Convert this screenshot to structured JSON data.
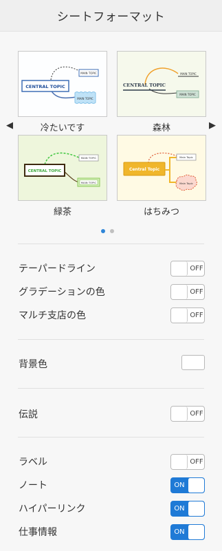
{
  "header": {
    "title": "シートフォーマット"
  },
  "themes": [
    {
      "label": "冷たいです",
      "central": "CENTRAL TOPIC",
      "main1": "MAIN TOPIC",
      "main2": "MAIN TOPIC"
    },
    {
      "label": "森林",
      "central": "CENTRAL TOPIC",
      "main1": "MAIN TOPIC",
      "main2": "MAIN TOPIC"
    },
    {
      "label": "緑茶",
      "central": "CENTRAL TOPIC",
      "main1": "MAIN TOPIC",
      "main2": "MAIN TOPIC"
    },
    {
      "label": "はちみつ",
      "central": "Central Topic",
      "main1": "Main Topic",
      "main2": "Main Topic"
    }
  ],
  "pager": {
    "page_count": 2,
    "active_page": 1
  },
  "settings": {
    "tapered_line": {
      "label": "テーパードライン",
      "state": "OFF"
    },
    "gradient_color": {
      "label": "グラデーションの色",
      "state": "OFF"
    },
    "multi_branch_color": {
      "label": "マルチ支店の色",
      "state": "OFF"
    },
    "background_color": {
      "label": "背景色",
      "value": "#ffffff"
    },
    "legend": {
      "label": "伝説",
      "state": "OFF"
    },
    "label": {
      "label": "ラベル",
      "state": "OFF"
    },
    "note": {
      "label": "ノート",
      "state": "ON"
    },
    "hyperlink": {
      "label": "ハイパーリンク",
      "state": "ON"
    },
    "task_info": {
      "label": "仕事情報",
      "state": "ON"
    }
  },
  "colors": {
    "accent": "#1f7ad6",
    "dot_active": "#2f86d8"
  }
}
